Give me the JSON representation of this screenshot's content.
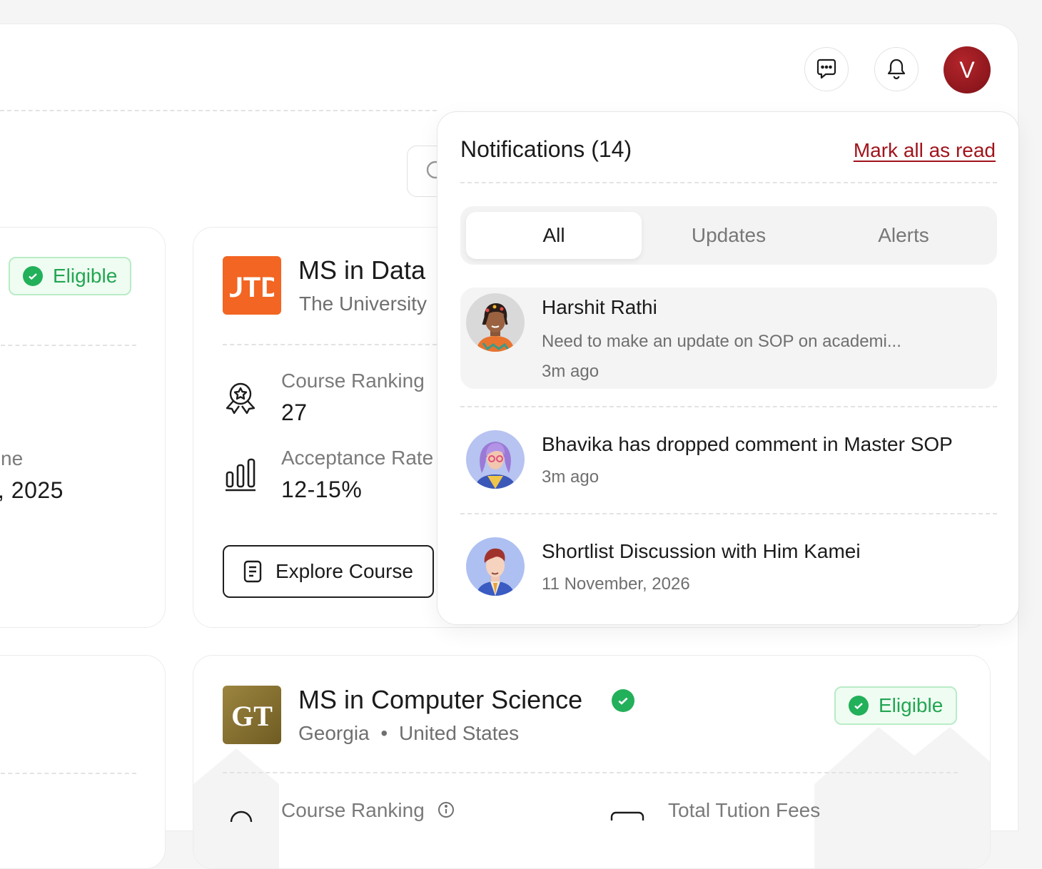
{
  "header": {
    "chat_icon": "chat-bubble-icon",
    "bell_icon": "bell-icon",
    "avatar_initial": "V"
  },
  "left_card": {
    "badge": "Eligible",
    "partial_label": "ne",
    "partial_value": ", 2025"
  },
  "course_card_1": {
    "title": "MS in Data",
    "university": "The University",
    "logo_text": "UTD",
    "ranking_label": "Course Ranking",
    "ranking_value": "27",
    "acceptance_label": "Acceptance Rate",
    "acceptance_value": "12-15%",
    "explore_label": "Explore Course"
  },
  "course_card_2": {
    "title": "MS in Computer Science",
    "location_city": "Georgia",
    "location_sep": "•",
    "location_country": "United States",
    "logo_text": "GT",
    "badge": "Eligible",
    "ranking_label": "Course Ranking",
    "fees_label": "Total Tution Fees"
  },
  "notifications": {
    "title": "Notifications (14)",
    "mark_all": "Mark all as read",
    "tabs": [
      {
        "label": "All",
        "active": true
      },
      {
        "label": "Updates",
        "active": false
      },
      {
        "label": "Alerts",
        "active": false
      }
    ],
    "items": [
      {
        "name": "Harshit Rathi",
        "message": "Need to make an update on SOP on academi...",
        "time": "3m ago"
      },
      {
        "name": "Bhavika has dropped comment in Master SOP",
        "time": "3m ago"
      },
      {
        "name": "Shortlist Discussion with Him Kamei",
        "time": "11 November, 2026"
      }
    ]
  },
  "colors": {
    "accent": "#a1141c",
    "eligible_green": "#22a652",
    "utd_orange": "#f26522",
    "gt_gold": "#8a7530"
  }
}
